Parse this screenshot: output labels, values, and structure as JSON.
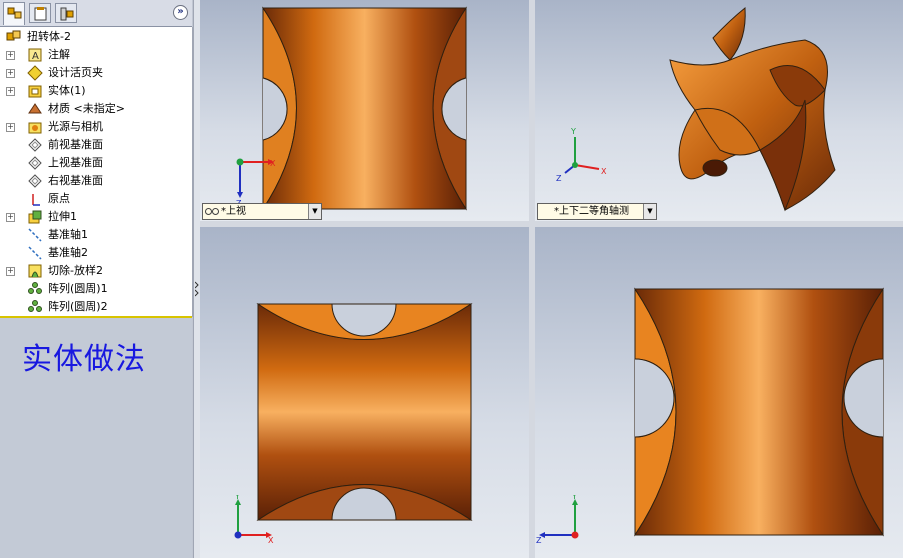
{
  "tree": {
    "root": "扭转体-2",
    "items": [
      {
        "label": "注解",
        "icon": "annotation-icon",
        "expand": true
      },
      {
        "label": "设计活页夹",
        "icon": "design-binder-icon",
        "expand": true
      },
      {
        "label": "实体(1)",
        "icon": "solid-body-icon",
        "expand": true
      },
      {
        "label": "材质 <未指定>",
        "icon": "material-icon",
        "expand": false
      },
      {
        "label": "光源与相机",
        "icon": "lights-camera-icon",
        "expand": true
      },
      {
        "label": "前视基准面",
        "icon": "plane-icon",
        "expand": false
      },
      {
        "label": "上视基准面",
        "icon": "plane-icon",
        "expand": false
      },
      {
        "label": "右视基准面",
        "icon": "plane-icon",
        "expand": false
      },
      {
        "label": "原点",
        "icon": "origin-icon",
        "expand": false
      },
      {
        "label": "拉伸1",
        "icon": "extrude-icon",
        "expand": true
      },
      {
        "label": "基准轴1",
        "icon": "axis-icon",
        "expand": false
      },
      {
        "label": "基准轴2",
        "icon": "axis-icon",
        "expand": false
      },
      {
        "label": "切除-放样2",
        "icon": "cut-loft-icon",
        "expand": true
      },
      {
        "label": "阵列(圆周)1",
        "icon": "circular-pattern-icon",
        "expand": false
      },
      {
        "label": "阵列(圆周)2",
        "icon": "circular-pattern-icon",
        "expand": false
      }
    ]
  },
  "note": "实体做法",
  "viewports": {
    "top_left": {
      "label": "*上视"
    },
    "top_right": {
      "label": "*上下二等角轴测"
    }
  },
  "axes": {
    "x": "X",
    "y": "Y",
    "z": "Z"
  },
  "colors": {
    "accent": "#d8c400",
    "note_text": "#1818e0",
    "part": "#d07018"
  }
}
